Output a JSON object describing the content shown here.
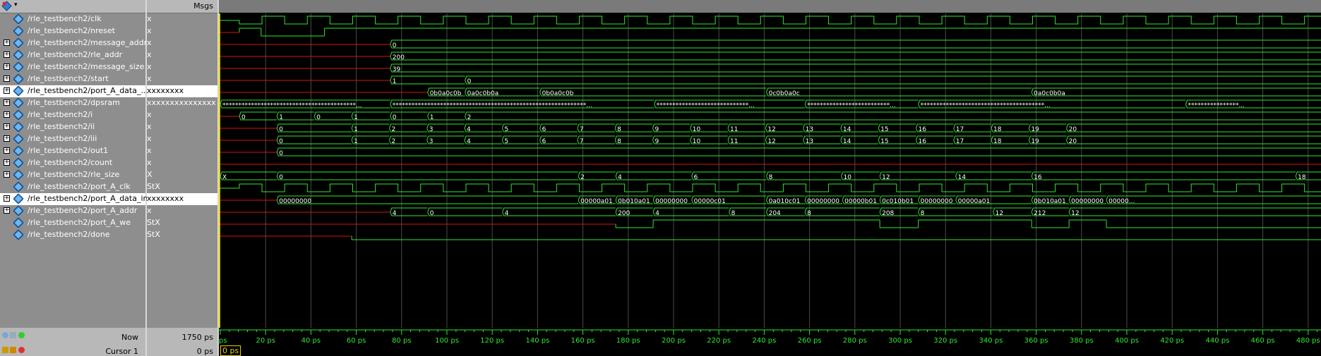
{
  "toolbar": {
    "msgs_label": "Msgs",
    "icon": "wave-diamond-icon",
    "arrow": "▾"
  },
  "colors": {
    "wave_green": "#2ee82e",
    "wave_red": "#e01010",
    "wave_text": "#ffffff",
    "cursor": "#e6d200"
  },
  "signals": [
    {
      "name": "/rle_testbench2/clk",
      "value": "x",
      "expandable": false
    },
    {
      "name": "/rle_testbench2/nreset",
      "value": "x",
      "expandable": false
    },
    {
      "name": "/rle_testbench2/message_addr",
      "value": "x",
      "expandable": true
    },
    {
      "name": "/rle_testbench2/rle_addr",
      "value": "x",
      "expandable": true
    },
    {
      "name": "/rle_testbench2/message_size",
      "value": "x",
      "expandable": true
    },
    {
      "name": "/rle_testbench2/start",
      "value": "x",
      "expandable": true
    },
    {
      "name": "/rle_testbench2/port_A_data_...",
      "value": "xxxxxxxx",
      "expandable": true,
      "selected": true
    },
    {
      "name": "/rle_testbench2/dpsram",
      "value": "xxxxxxxxxxxxxxxxxxx",
      "expandable": true
    },
    {
      "name": "/rle_testbench2/i",
      "value": "x",
      "expandable": true
    },
    {
      "name": "/rle_testbench2/ii",
      "value": "x",
      "expandable": true
    },
    {
      "name": "/rle_testbench2/iii",
      "value": "x",
      "expandable": true
    },
    {
      "name": "/rle_testbench2/out1",
      "value": "x",
      "expandable": true
    },
    {
      "name": "/rle_testbench2/count",
      "value": "x",
      "expandable": true
    },
    {
      "name": "/rle_testbench2/rle_size",
      "value": "X",
      "expandable": true
    },
    {
      "name": "/rle_testbench2/port_A_clk",
      "value": "StX",
      "expandable": false
    },
    {
      "name": "/rle_testbench2/port_A_data_in",
      "value": "xxxxxxxx",
      "expandable": true,
      "selected": true
    },
    {
      "name": "/rle_testbench2/port_A_addr",
      "value": "x",
      "expandable": true
    },
    {
      "name": "/rle_testbench2/port_A_we",
      "value": "StX",
      "expandable": false
    },
    {
      "name": "/rle_testbench2/done",
      "value": "StX",
      "expandable": false
    }
  ],
  "waves": {
    "dpsram_segments": [
      "******************************************...",
      "*************************************************************...",
      "*****************************...",
      "**************************...",
      "***************************************...",
      "****************..."
    ],
    "message_addr_labels": [
      "0"
    ],
    "rle_addr_labels": [
      "200"
    ],
    "message_size_labels": [
      "39"
    ],
    "start_labels": [
      "1",
      "0"
    ],
    "port_A_data_out_labels": [
      "0b0a0c0b",
      "0a0c0b0a",
      "0b0a0c0b",
      "0c0b0a0c",
      "0a0c0b0a"
    ],
    "i_labels": [
      "0",
      "1",
      "0",
      "1",
      "0",
      "1",
      "2"
    ],
    "ii_labels": [
      "0",
      "1",
      "2",
      "3",
      "4",
      "5",
      "6",
      "7",
      "8",
      "9",
      "10",
      "11",
      "12",
      "13",
      "14",
      "15",
      "16",
      "17",
      "18",
      "19",
      "20"
    ],
    "iii_labels": [
      "0",
      "1",
      "2",
      "3",
      "4",
      "5",
      "6",
      "7",
      "8",
      "9",
      "10",
      "11",
      "12",
      "13",
      "14",
      "15",
      "16",
      "17",
      "18",
      "19",
      "20"
    ],
    "out1_labels": [
      "0"
    ],
    "rle_size_labels": [
      "X",
      "0",
      "2",
      "4",
      "6",
      "8",
      "10",
      "12",
      "14",
      "16",
      "18"
    ],
    "data_in_labels": [
      "00000000",
      "00000a01",
      "0b010a01",
      "00000000",
      "00000c01",
      "0a010c01",
      "00000000",
      "00000b01",
      "0c010b01",
      "00000000",
      "00000a01",
      "0b010a01",
      "00000000",
      "00000..."
    ],
    "addr_labels": [
      "4",
      "0",
      "4",
      "200",
      "4",
      "8",
      "204",
      "8",
      "208",
      "8",
      "12",
      "212",
      "12"
    ]
  },
  "timeline": {
    "ticks": [
      "ps",
      "20 ps",
      "40 ps",
      "60 ps",
      "80 ps",
      "100 ps",
      "120 ps",
      "140 ps",
      "160 ps",
      "180 ps",
      "200 ps",
      "220 ps",
      "240 ps",
      "260 ps",
      "280 ps",
      "300 ps",
      "320 ps",
      "340 ps",
      "360 ps",
      "380 ps",
      "400 ps",
      "420 ps",
      "440 ps",
      "460 ps",
      "480 ps"
    ]
  },
  "status": {
    "now_label": "Now",
    "now_value": "1750 ps",
    "cursor_label": "Cursor 1",
    "cursor_value": "0 ps",
    "cursor_box": "0 ps"
  }
}
